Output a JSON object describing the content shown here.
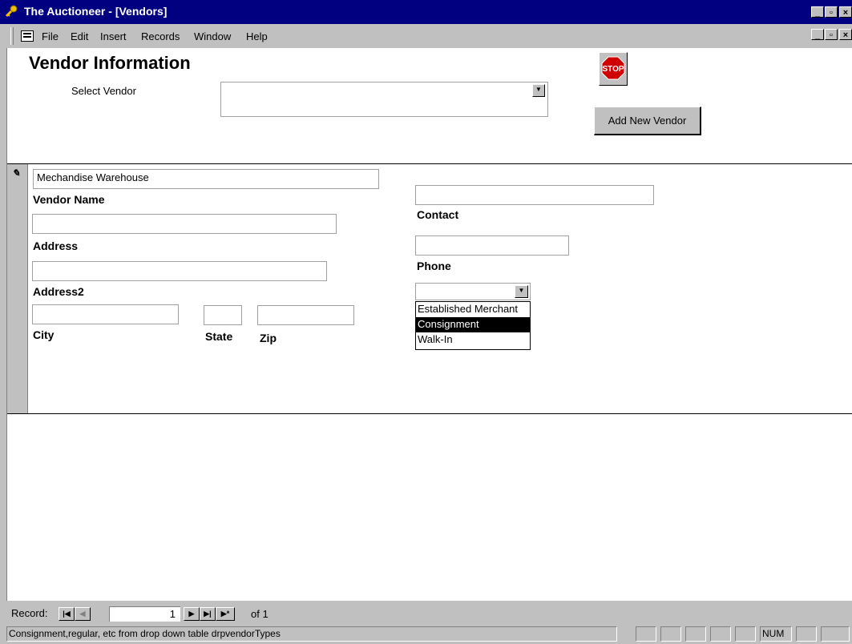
{
  "window": {
    "title": "The Auctioneer - [Vendors]"
  },
  "menu": {
    "items": [
      "File",
      "Edit",
      "Insert",
      "Records",
      "Window",
      "Help"
    ]
  },
  "form": {
    "heading": "Vendor Information",
    "select_vendor_label": "Select Vendor",
    "select_vendor_value": "",
    "add_new_vendor_label": "Add New Vendor",
    "stop_label": "STOP",
    "vendor_name_value": "Mechandise Warehouse",
    "vendor_name_label": "Vendor Name",
    "address_value": "",
    "address_label": "Address",
    "address2_value": "",
    "address2_label": "Address2",
    "city_value": "",
    "city_label": "City",
    "state_value": "",
    "state_label": "State",
    "zip_value": "",
    "zip_label": "Zip",
    "contact_value": "",
    "contact_label": "Contact",
    "phone_value": "",
    "phone_label": "Phone",
    "vendor_type_value": "",
    "vendor_type_options": [
      "Established Merchant",
      "Consignment",
      "Walk-In"
    ],
    "vendor_type_selected": "Consignment"
  },
  "navigator": {
    "record_label": "Record:",
    "current": "1",
    "of_label": "of 1"
  },
  "status_bar": {
    "text": "Consignment,regular, etc from drop down table drpvendorTypes",
    "num_indicator": "NUM"
  }
}
